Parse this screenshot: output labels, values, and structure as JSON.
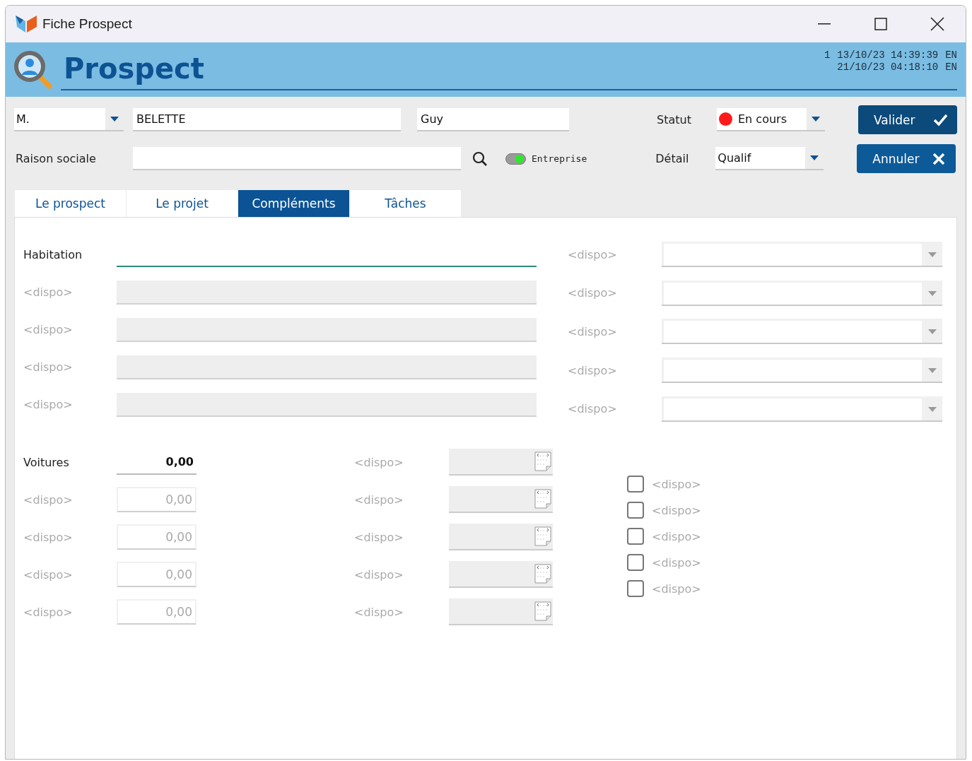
{
  "window": {
    "title": "Fiche Prospect"
  },
  "header": {
    "title": "Prospect",
    "info": [
      {
        "count": "1",
        "date": "13/10/23 14:39:39",
        "user": "EN"
      },
      {
        "date": "21/10/23 04:18:10",
        "user": "EN"
      }
    ]
  },
  "identity": {
    "civility": "M.",
    "last_name": "BELETTE",
    "first_name": "Guy",
    "company_label": "Raison sociale",
    "company_toggle": {
      "label": "Entreprise",
      "on": true
    },
    "status": {
      "label": "Statut",
      "value": "En cours",
      "color": "#ff1a1a"
    },
    "detail": {
      "label": "Détail",
      "value": "Qualif"
    }
  },
  "buttons": [
    {
      "label": "Valider",
      "kind": "ok"
    },
    {
      "label": "Annuler",
      "kind": "cancel"
    }
  ],
  "tabs": [
    {
      "label": "Le prospect",
      "selected": false
    },
    {
      "label": "Le projet",
      "selected": false
    },
    {
      "label": "Compléments",
      "selected": true
    },
    {
      "label": "Tâches",
      "selected": false
    }
  ],
  "text_fields": [
    {
      "label": "Habitation",
      "disabled": false
    },
    {
      "label": "<dispo>",
      "disabled": true
    },
    {
      "label": "<dispo>",
      "disabled": true
    },
    {
      "label": "<dispo>",
      "disabled": true
    },
    {
      "label": "<dispo>",
      "disabled": true
    }
  ],
  "combos": [
    {
      "label": "<dispo>"
    },
    {
      "label": "<dispo>"
    },
    {
      "label": "<dispo>"
    },
    {
      "label": "<dispo>"
    },
    {
      "label": "<dispo>"
    }
  ],
  "number_fields": [
    {
      "label": "Voitures",
      "value": "0,00",
      "disabled": false
    },
    {
      "label": "<dispo>",
      "value": "0,00",
      "disabled": true
    },
    {
      "label": "<dispo>",
      "value": "0,00",
      "disabled": true
    },
    {
      "label": "<dispo>",
      "value": "0,00",
      "disabled": true
    },
    {
      "label": "<dispo>",
      "value": "0,00",
      "disabled": true
    }
  ],
  "date_fields": [
    {
      "label": "<dispo>"
    },
    {
      "label": "<dispo>"
    },
    {
      "label": "<dispo>"
    },
    {
      "label": "<dispo>"
    },
    {
      "label": "<dispo>"
    }
  ],
  "checkboxes": [
    {
      "label": "<dispo>",
      "checked": false
    },
    {
      "label": "<dispo>",
      "checked": false
    },
    {
      "label": "<dispo>",
      "checked": false
    },
    {
      "label": "<dispo>",
      "checked": false
    },
    {
      "label": "<dispo>",
      "checked": false
    }
  ]
}
